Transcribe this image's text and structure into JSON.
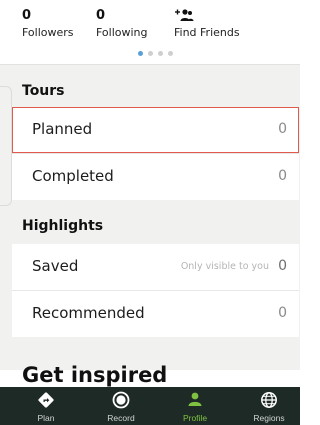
{
  "stats": {
    "followers": {
      "count": "0",
      "label": "Followers"
    },
    "following": {
      "count": "0",
      "label": "Following"
    },
    "find_friends": {
      "label": "Find Friends",
      "icon": "add-friends-icon"
    }
  },
  "carousel": {
    "page_count": 4,
    "active_index": 0
  },
  "tours": {
    "title": "Tours",
    "rows": [
      {
        "label": "Planned",
        "count": "0"
      },
      {
        "label": "Completed",
        "count": "0"
      }
    ]
  },
  "highlights": {
    "title": "Highlights",
    "rows": [
      {
        "label": "Saved",
        "note": "Only visible to you",
        "count": "0"
      },
      {
        "label": "Recommended",
        "count": "0"
      }
    ]
  },
  "inspired": {
    "title": "Get inspired"
  },
  "nav": {
    "items": [
      {
        "label": "Plan",
        "icon": "plan-icon"
      },
      {
        "label": "Record",
        "icon": "record-icon"
      },
      {
        "label": "Profile",
        "icon": "profile-icon",
        "active": true
      },
      {
        "label": "Regions",
        "icon": "globe-icon"
      }
    ]
  },
  "colors": {
    "accent_green": "#7fc241",
    "selected_outline": "#e05a4e",
    "navbar_bg": "#1e2a26",
    "active_dot": "#5aa0d8"
  }
}
